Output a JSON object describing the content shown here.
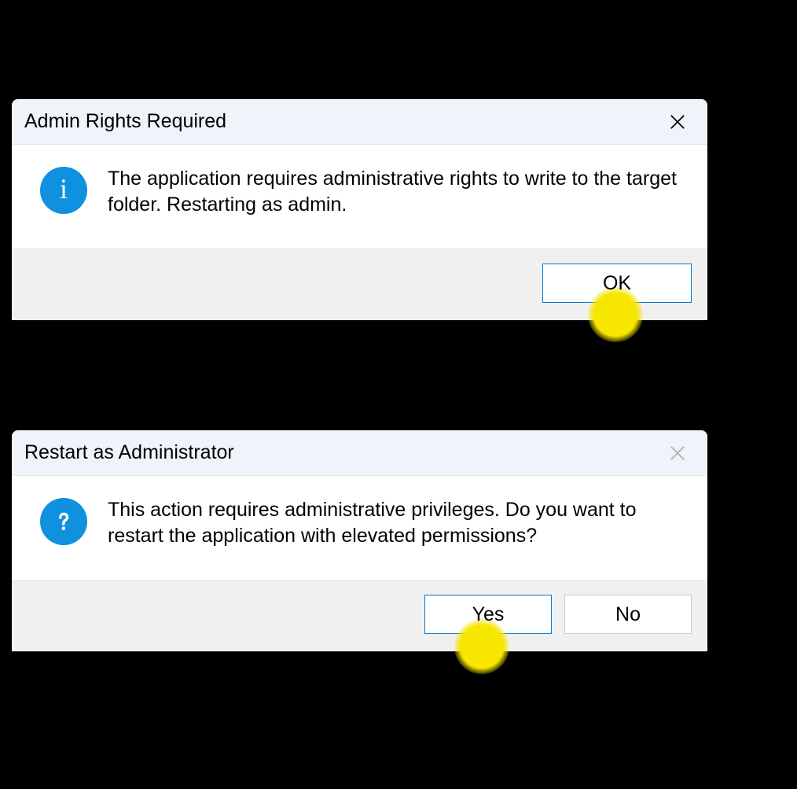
{
  "dialogs": [
    {
      "title": "Admin Rights Required",
      "icon": "info",
      "message": "The application requires administrative rights to write to the target folder. Restarting as admin.",
      "close_enabled": true,
      "buttons": {
        "ok": "OK"
      }
    },
    {
      "title": "Restart as Administrator",
      "icon": "question",
      "message": "This action requires administrative privileges. Do you want to restart the application with elevated permissions?",
      "close_enabled": false,
      "buttons": {
        "yes": "Yes",
        "no": "No"
      }
    }
  ],
  "colors": {
    "accent": "#0078d4",
    "icon_bg": "#0f91e0",
    "highlight": "#f7e600"
  }
}
